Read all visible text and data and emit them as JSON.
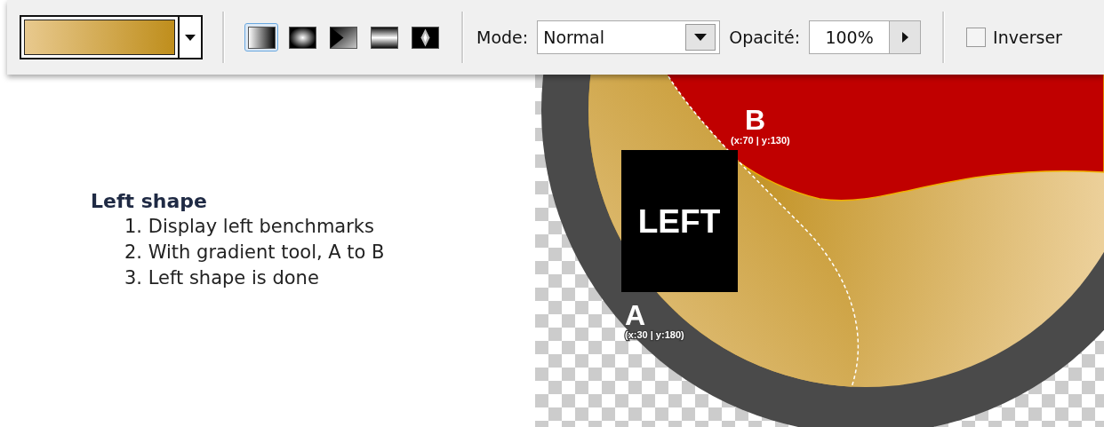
{
  "toolbar": {
    "gradient_types": [
      {
        "kind": "linear",
        "selected": true
      },
      {
        "kind": "radial",
        "selected": false
      },
      {
        "kind": "angle",
        "selected": false
      },
      {
        "kind": "reflected",
        "selected": false
      },
      {
        "kind": "diamond",
        "selected": false
      }
    ],
    "mode": {
      "label": "Mode:",
      "value": "Normal"
    },
    "opacity": {
      "label": "Opacité:",
      "value": "100%"
    },
    "invert": {
      "label": "Inverser",
      "checked": false
    }
  },
  "instructions": {
    "title": "Left shape",
    "steps": [
      "1. Display left benchmarks",
      "2. With gradient tool, A to B",
      "3. Left shape is done"
    ]
  },
  "canvas": {
    "box_label": "LEFT",
    "point_b": {
      "name": "B",
      "coords": "(x:70 | y:130)"
    },
    "point_a": {
      "name": "A",
      "coords": "(x:30 | y:180)"
    }
  }
}
